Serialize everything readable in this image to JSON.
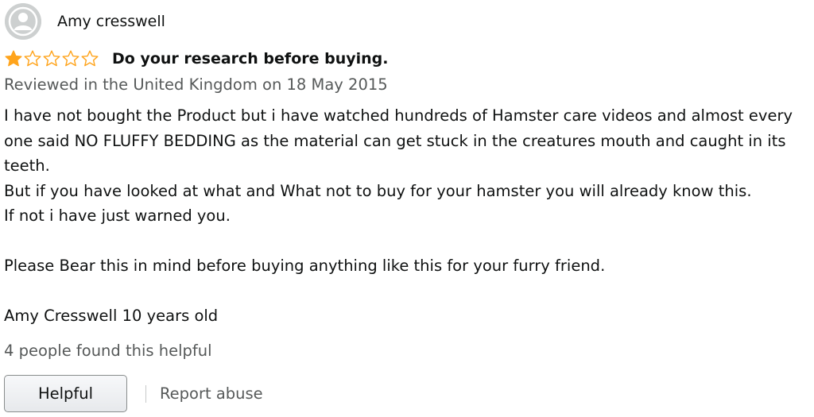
{
  "reviewer": {
    "name": "Amy cresswell",
    "avatar_icon": "user-silhouette-icon"
  },
  "review": {
    "rating": 1,
    "max_rating": 5,
    "star_color": "#ffa41c",
    "title": "Do your research before buying.",
    "date": "Reviewed in the United Kingdom on 18 May 2015",
    "body": [
      "I have not bought the Product but i have watched hundreds of Hamster care videos and almost every one said NO FLUFFY BEDDING as the material can get stuck in the creatures mouth and caught in its teeth.",
      "But if you have looked at what and What not to buy for your hamster you will already know this.",
      "If not i have just warned you.",
      "",
      "Please Bear this in mind before buying anything like this for your furry friend.",
      "",
      "Amy Cresswell 10 years old"
    ]
  },
  "helpful_count_text": "4 people found this helpful",
  "actions": {
    "helpful_label": "Helpful",
    "report_label": "Report abuse"
  }
}
